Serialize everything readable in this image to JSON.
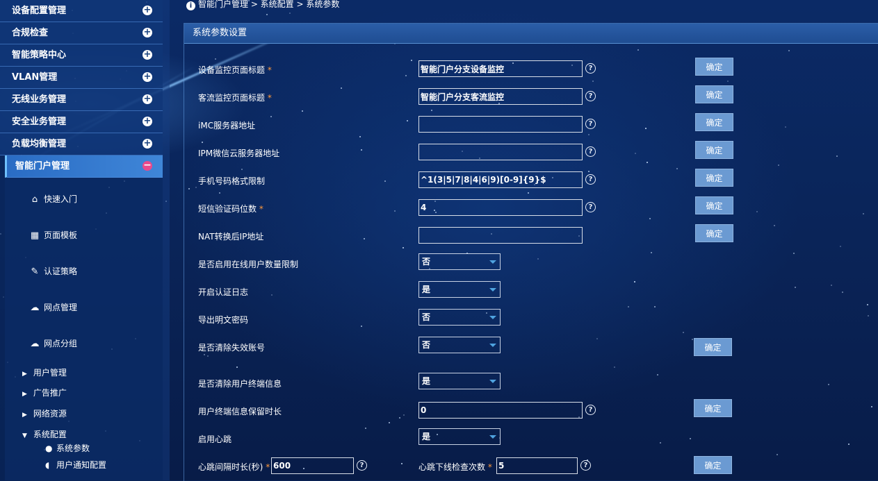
{
  "sidebar": {
    "menu": [
      {
        "label": "设备配置管理",
        "icon": "plus-icon"
      },
      {
        "label": "合规检查",
        "icon": "plus-icon"
      },
      {
        "label": "智能策略中心",
        "icon": "plus-icon"
      },
      {
        "label": "VLAN管理",
        "icon": "plus-icon"
      },
      {
        "label": "无线业务管理",
        "icon": "plus-icon"
      },
      {
        "label": "安全业务管理",
        "icon": "plus-icon"
      },
      {
        "label": "负载均衡管理",
        "icon": "plus-icon"
      }
    ],
    "active": {
      "label": "智能门户管理",
      "icon": "minus-icon"
    },
    "sub": [
      {
        "label": "快速入门",
        "icon": "home-icon"
      },
      {
        "label": "页面模板",
        "icon": "template-icon"
      },
      {
        "label": "认证策略",
        "icon": "auth-policy-icon"
      },
      {
        "label": "网点管理",
        "icon": "cloud-icon"
      },
      {
        "label": "网点分组",
        "icon": "cloud-group-icon"
      }
    ],
    "tree": [
      {
        "label": "用户管理",
        "expanded": false
      },
      {
        "label": "广告推广",
        "expanded": false
      },
      {
        "label": "网络资源",
        "expanded": false
      },
      {
        "label": "系统配置",
        "expanded": true
      }
    ],
    "leaves": [
      {
        "label": "系统参数",
        "icon": "info-icon"
      },
      {
        "label": "用户通知配置",
        "icon": "notify-icon"
      }
    ]
  },
  "breadcrumb": "智能门户管理 > 系统配置 > 系统参数",
  "panel": {
    "title": "系统参数设置",
    "confirm_label": "确定",
    "help_glyph": "?",
    "rows": {
      "r1": {
        "label": "设备监控页面标题",
        "required": "*",
        "value": "智能门户分支设备监控"
      },
      "r2": {
        "label": "客流监控页面标题",
        "required": "*",
        "value": "智能门户分支客流监控"
      },
      "r3": {
        "label": "iMC服务器地址",
        "value": ""
      },
      "r4": {
        "label": "IPM微信云服务器地址",
        "value": ""
      },
      "r5": {
        "label": "手机号码格式限制",
        "value": "^1(3|5|7|8|4|6|9)[0-9]{9}$"
      },
      "r6": {
        "label": "短信验证码位数",
        "required": "*",
        "value": "4"
      },
      "r7": {
        "label": "NAT转换后IP地址",
        "value": ""
      },
      "r8": {
        "label": "是否启用在线用户数量限制",
        "selected": "否"
      },
      "r9": {
        "label": "开启认证日志",
        "selected": "是"
      },
      "r10": {
        "label": "导出明文密码",
        "selected": "否"
      },
      "r11": {
        "label": "是否清除失效账号",
        "selected": "否"
      },
      "r12": {
        "label": "是否清除用户终端信息",
        "selected": "是"
      },
      "r13": {
        "label": "用户终端信息保留时长",
        "value": "0"
      },
      "r14": {
        "label": "启用心跳",
        "selected": "是"
      },
      "r15": {
        "label": "心跳间隔时长(秒)",
        "required": "*",
        "value": "600",
        "label2": "心跳下线检查次数",
        "required2": "*",
        "value2": "5"
      }
    }
  }
}
